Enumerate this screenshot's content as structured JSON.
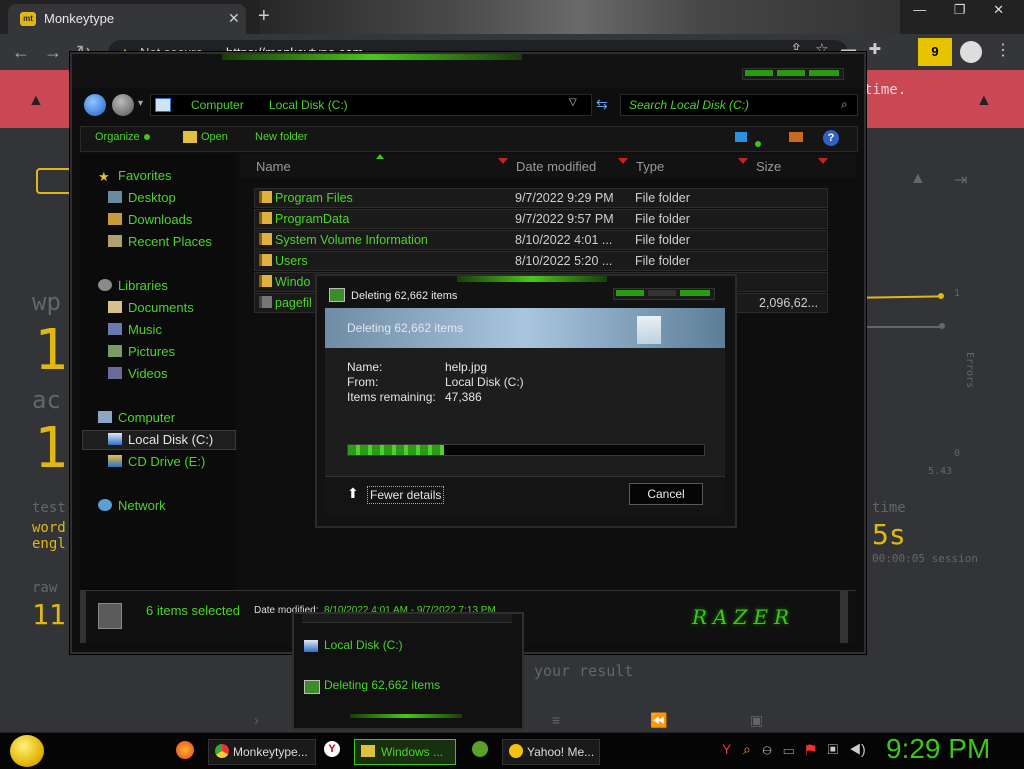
{
  "browser": {
    "tab_title": "Monkeytype",
    "tab_favicon": "mt",
    "new_tab": "+",
    "url_warning": "Not secure",
    "url": "https://monkeytype.com",
    "clock_ext": "9",
    "window_controls": "— ❐ ✕"
  },
  "monkeytype": {
    "banner_text": "time.",
    "labels": {
      "wpm": "wp",
      "wpm_val": "1",
      "acc": "ac",
      "acc_val": "1",
      "test": "test",
      "word": "word",
      "lang": "engl",
      "raw": "raw",
      "raw_val": "11",
      "time": "time",
      "time_val": "5s",
      "session": "00:00:05 session",
      "errors": "Errors",
      "y_top": "1",
      "y_bot": "0",
      "x_last": "5.43",
      "result": "your result"
    }
  },
  "explorer": {
    "path": [
      "Computer",
      "Local Disk (C:)"
    ],
    "search_placeholder": "Search Local Disk (C:)",
    "commands": {
      "organize": "Organize",
      "open": "Open",
      "new_folder": "New folder"
    },
    "nav": {
      "favorites": "Favorites",
      "desktop": "Desktop",
      "downloads": "Downloads",
      "recent": "Recent Places",
      "libraries": "Libraries",
      "documents": "Documents",
      "music": "Music",
      "pictures": "Pictures",
      "videos": "Videos",
      "computer": "Computer",
      "local_disk": "Local Disk (C:)",
      "cd_drive": "CD Drive (E:)",
      "network": "Network"
    },
    "columns": {
      "name": "Name",
      "date": "Date modified",
      "type": "Type",
      "size": "Size"
    },
    "rows": [
      {
        "name": "Program Files",
        "date": "9/7/2022 9:29 PM",
        "type": "File folder",
        "size": ""
      },
      {
        "name": "ProgramData",
        "date": "9/7/2022 9:57 PM",
        "type": "File folder",
        "size": ""
      },
      {
        "name": "System Volume Information",
        "date": "8/10/2022 4:01 ...",
        "type": "File folder",
        "size": ""
      },
      {
        "name": "Users",
        "date": "8/10/2022 5:20 ...",
        "type": "File folder",
        "size": ""
      },
      {
        "name": "Windo",
        "date": "",
        "type": "",
        "size": ""
      },
      {
        "name": "pagefil",
        "date": "",
        "type": "",
        "size": "2,096,62..."
      }
    ],
    "status": {
      "count": "6 items selected",
      "date_label": "Date modified:",
      "date_value": "8/10/2022 4:01 AM - 9/7/2022 7:13 PM",
      "brand": "RAZER"
    }
  },
  "dialog": {
    "title": "Deleting 62,662 items",
    "header": "Deleting 62,662 items",
    "name_label": "Name:",
    "name_value": "help.jpg",
    "from_label": "From:",
    "from_value": "Local Disk (C:)",
    "remaining_label": "Items remaining:",
    "remaining_value": "47,386",
    "progress": 0.27,
    "fewer": "Fewer details",
    "cancel": "Cancel"
  },
  "popup": {
    "item1": "Local Disk (C:)",
    "item2": "Deleting 62,662 items"
  },
  "taskbar": {
    "chrome": "Monkeytype...",
    "windows": "Windows ...",
    "yahoo": "Yahoo! Me...",
    "time": "9:29 PM"
  },
  "colors": {
    "accent_green": "#4cd42a",
    "mt_yellow": "#e2b714",
    "banner_red": "#ca4754"
  }
}
